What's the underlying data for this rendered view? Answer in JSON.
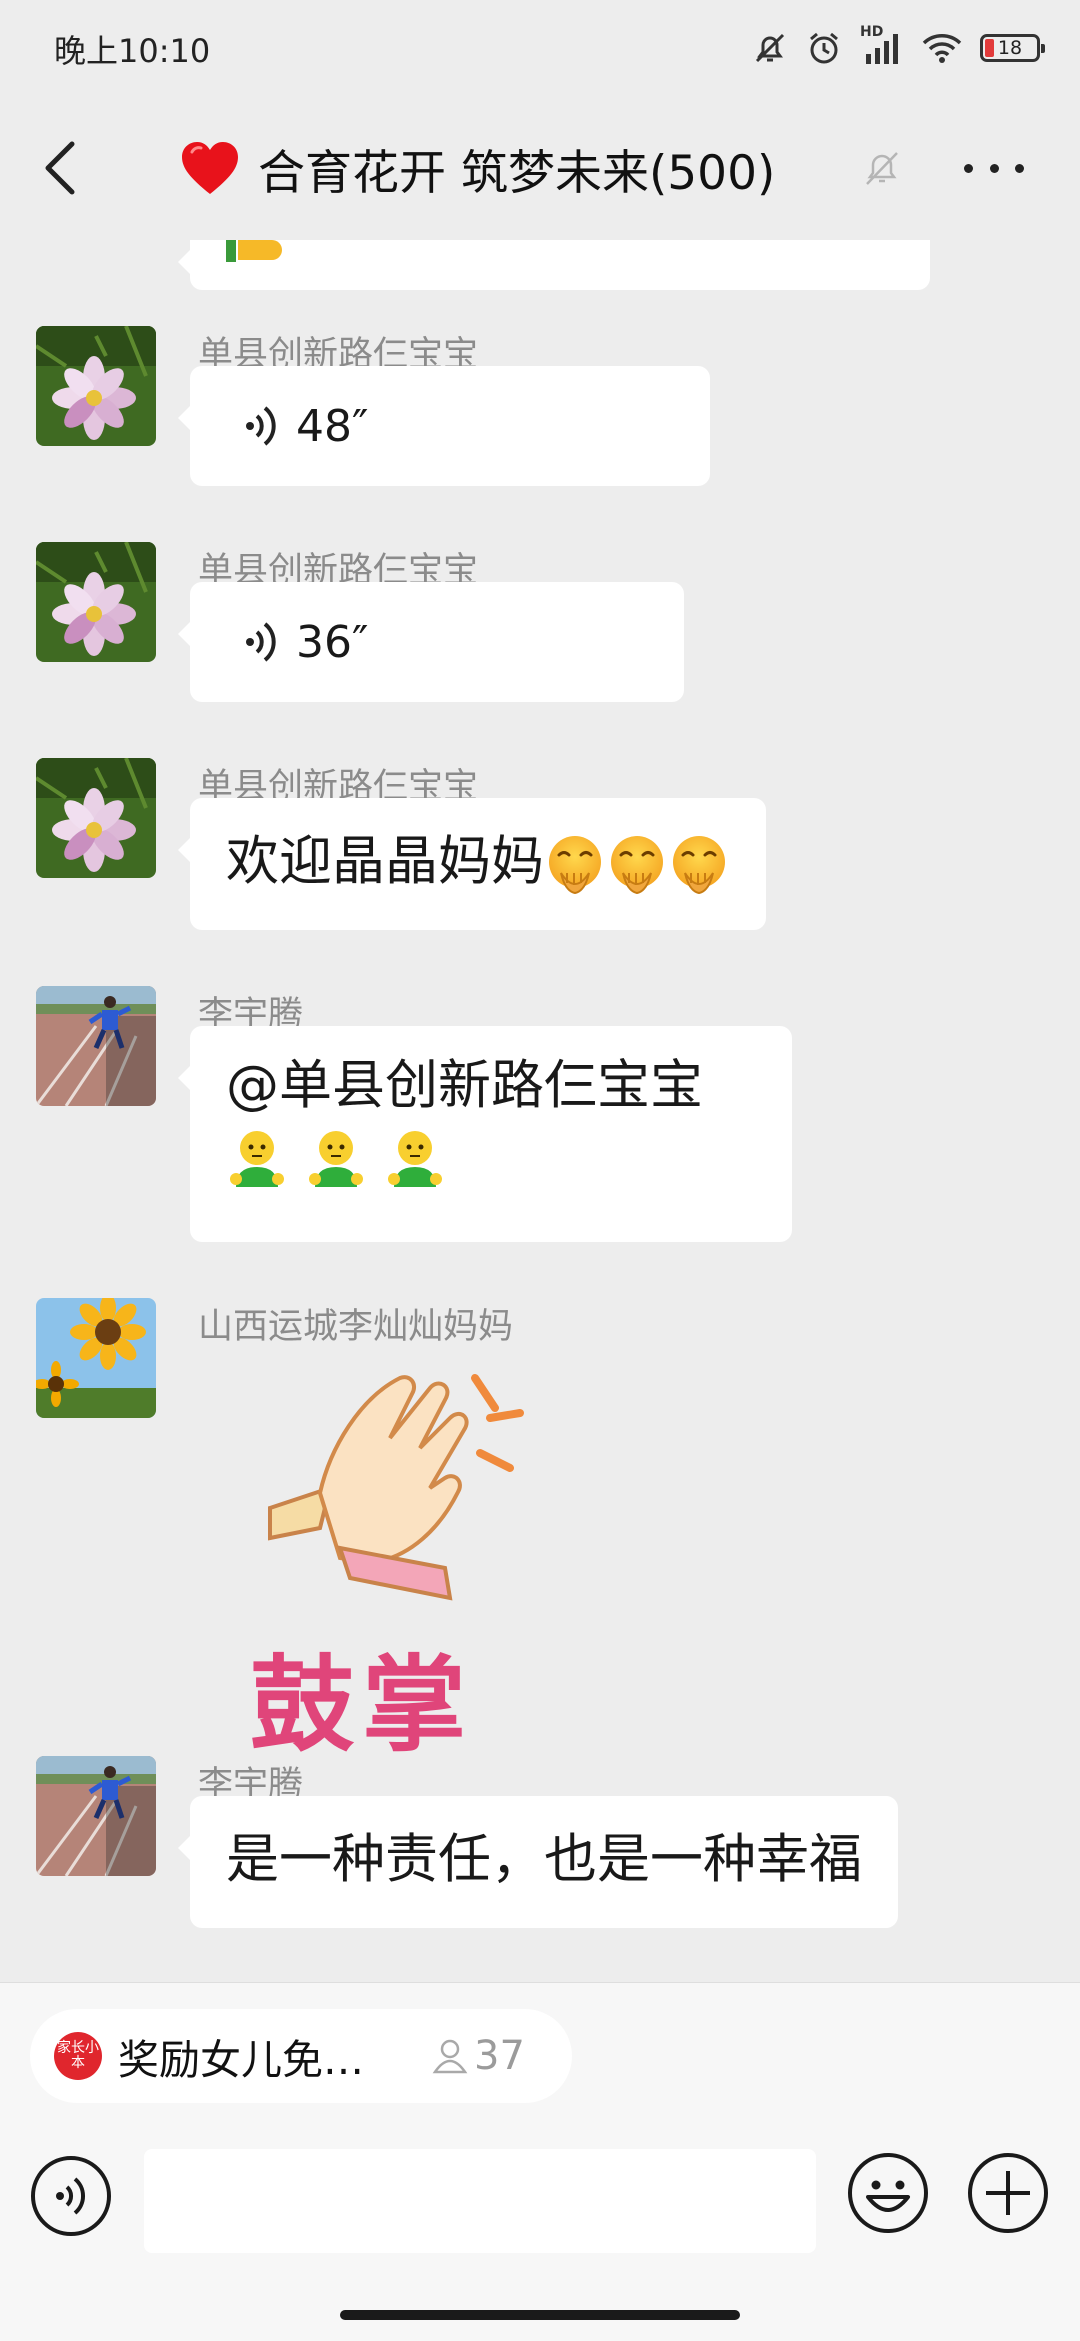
{
  "status_bar": {
    "time": "晚上10:10",
    "network": "HD",
    "battery": "18"
  },
  "header": {
    "title": "合育花开 筑梦未来(500)"
  },
  "messages": [
    {
      "sender": "单县创新路仨宝宝",
      "duration": "48″"
    },
    {
      "sender": "单县创新路仨宝宝",
      "duration": "36″"
    },
    {
      "sender": "单县创新路仨宝宝",
      "text": "欢迎晶晶妈妈"
    },
    {
      "sender": "李宇腾",
      "text": "@单县创新路仨宝宝"
    },
    {
      "sender": "山西运城李灿灿妈妈",
      "sticker_text": "鼓掌"
    },
    {
      "sender": "李宇腾",
      "text": "是一种责任，也是一种幸福"
    }
  ],
  "notice": {
    "logo": "家长小本",
    "text": "奖励女儿免…",
    "count": "37"
  },
  "colors": {
    "background": "#ededed",
    "bubble": "#ffffff",
    "accent_red": "#e0262d"
  },
  "icons": [
    "back-icon",
    "heart-icon",
    "mute-bell-icon",
    "more-icon",
    "voice-wave-icon",
    "emoji-icon",
    "plus-icon"
  ]
}
